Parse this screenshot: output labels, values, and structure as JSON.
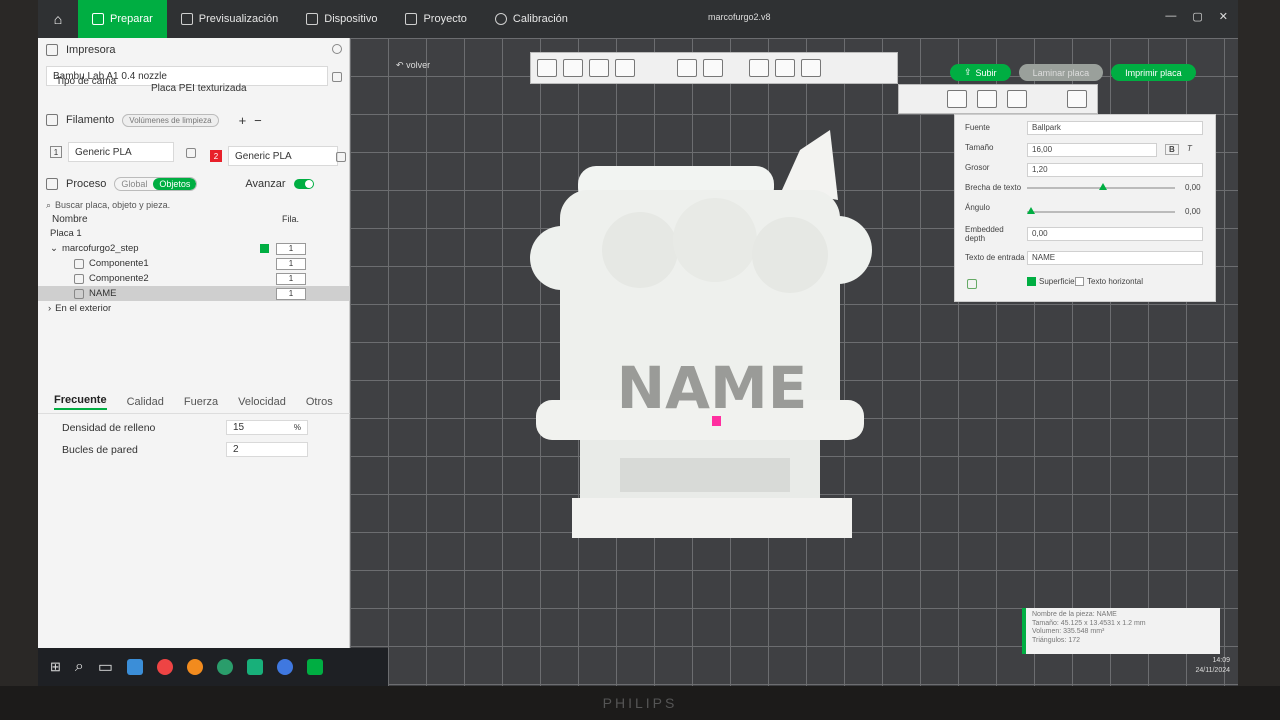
{
  "window": {
    "title": "marcofurgo2.v8"
  },
  "topbar": {
    "tabs": [
      {
        "label": "Preparar"
      },
      {
        "label": "Previsualización"
      },
      {
        "label": "Dispositivo"
      },
      {
        "label": "Proyecto"
      },
      {
        "label": "Calibración"
      }
    ]
  },
  "printer": {
    "section": "Impresora",
    "model": "Bambu Lab A1 0.4 nozzle",
    "bed_label": "Tipo de cama",
    "bed_value": "Placa PEI texturizada"
  },
  "filament": {
    "section": "Filamento",
    "purge": "Volúmenes de limpieza",
    "items": [
      {
        "num": "1",
        "name": "Generic PLA"
      },
      {
        "num": "2",
        "name": "Generic PLA"
      }
    ]
  },
  "process": {
    "section": "Proceso",
    "global": "Global",
    "objects": "Objetos",
    "advanced": "Avanzar",
    "search_placeholder": "Buscar placa, objeto y pieza.",
    "col_name": "Nombre",
    "col_fila": "Fila."
  },
  "tree": [
    {
      "label": "Placa 1"
    },
    {
      "label": "marcofurgo2_step",
      "count": "1"
    },
    {
      "label": "Componente1",
      "count": "1"
    },
    {
      "label": "Componente2",
      "count": "1"
    },
    {
      "label": "NAME",
      "count": "1"
    },
    {
      "label": "En el exterior"
    }
  ],
  "settings_tabs": [
    "Frecuente",
    "Calidad",
    "Fuerza",
    "Velocidad",
    "Otros"
  ],
  "settings": [
    {
      "label": "Densidad de relleno",
      "value": "15",
      "unit": "%"
    },
    {
      "label": "Bucles de pared",
      "value": "2"
    }
  ],
  "viewport": {
    "back": "volver",
    "buttons": {
      "upload": "Subir",
      "slice": "Laminar placa",
      "print": "Imprimir placa"
    }
  },
  "text_panel": {
    "font_label": "Fuente",
    "font_value": "Ballpark",
    "size_label": "Tamaño",
    "size_value": "16,00",
    "thickness_label": "Grosor",
    "thickness_value": "1,20",
    "gap_label": "Brecha de texto",
    "gap_value": "0,00",
    "angle_label": "Ángulo",
    "angle_value": "0,00",
    "embedded_label": "Embedded depth",
    "embedded_value": "0,00",
    "input_label": "Texto de entrada",
    "input_value": "NAME",
    "surface_label": "Superficie",
    "horizontal_label": "Texto horizontal"
  },
  "model_text": "NAME",
  "info": {
    "name": "Nombre de la pieza: NAME",
    "size": "Tamaño: 45.125 x 13.4531 x 1.2 mm",
    "volume": "Volumen: 335.548 mm³",
    "triangles": "Triángulos: 172"
  },
  "clock": {
    "time": "14:09",
    "date": "24/11/2024"
  },
  "bezel": "PHILIPS",
  "colors": {
    "accent": "#00ae42",
    "filament2": "#e8202a"
  }
}
